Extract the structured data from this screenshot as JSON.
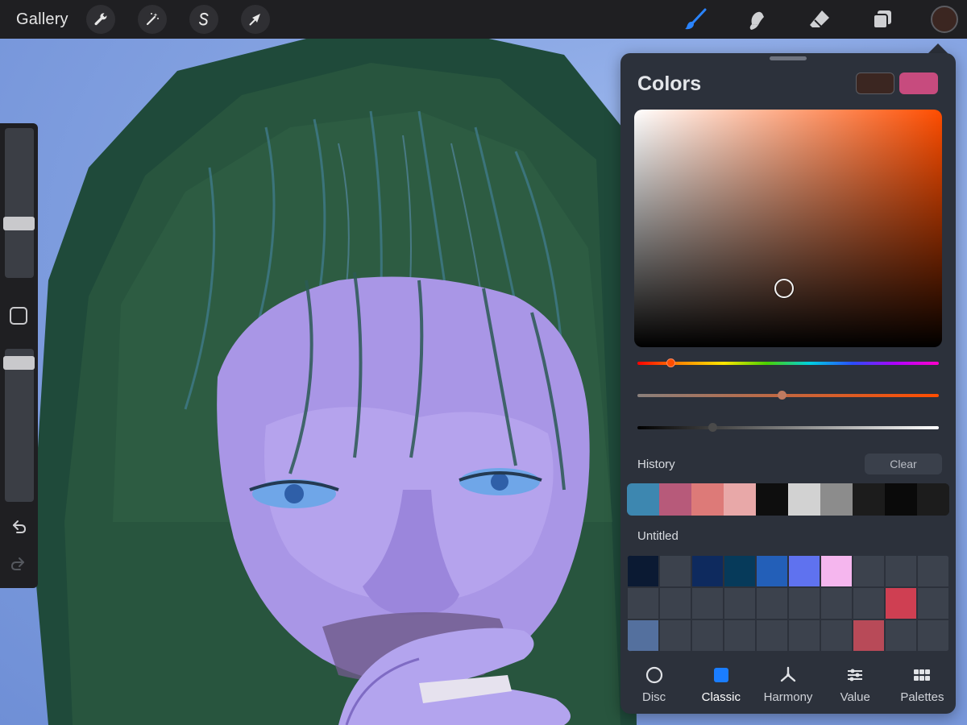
{
  "topbar": {
    "gallery_label": "Gallery",
    "left_tools": [
      "wrench-icon",
      "magic-wand-icon",
      "selection-s-icon",
      "arrow-transform-icon"
    ],
    "right_tools": [
      "brush-icon",
      "smudge-icon",
      "eraser-icon",
      "layers-icon"
    ],
    "current_color": "#3b2621"
  },
  "sidebar": {
    "brush_size_level": 0.35,
    "opacity_level": 0.05
  },
  "colors_panel": {
    "title": "Colors",
    "current_color": "#3b2621",
    "previous_color": "#c74b7e",
    "hue_fraction": 0.11,
    "saturation_fraction": 0.48,
    "brightness_fraction": 0.25,
    "history_label": "History",
    "clear_label": "Clear",
    "history_colors": [
      "#3d87b0",
      "#b75a7a",
      "#dd7a78",
      "#e8a8a8",
      "#0e0e0e",
      "#d2d2d2",
      "#8c8c8c",
      "#1c1c1c",
      "#0a0a0a",
      "#1c1c1c"
    ],
    "palette_name": "Untitled",
    "palette_colors": [
      "#0b1a33",
      "#3c424d",
      "#0e2a5e",
      "#063a5a",
      "#235fb8",
      "#5f72ef",
      "#f5b6ee",
      "#3c424d",
      "#3c424d",
      "#3c424d",
      "#3c424d",
      "#3c424d",
      "#3c424d",
      "#3c424d",
      "#3c424d",
      "#3c424d",
      "#3c424d",
      "#3c424d",
      "#cf3f52",
      "#3c424d",
      "#54709e",
      "#3c424d",
      "#3c424d",
      "#3c424d",
      "#3c424d",
      "#3c424d",
      "#3c424d",
      "#b84a58",
      "#3c424d",
      "#3c424d"
    ],
    "tabs": [
      {
        "label": "Disc",
        "icon": "disc-icon"
      },
      {
        "label": "Classic",
        "icon": "classic-square-icon"
      },
      {
        "label": "Harmony",
        "icon": "harmony-icon"
      },
      {
        "label": "Value",
        "icon": "sliders-icon"
      },
      {
        "label": "Palettes",
        "icon": "palettes-grid-icon"
      }
    ],
    "active_tab": "Classic"
  }
}
